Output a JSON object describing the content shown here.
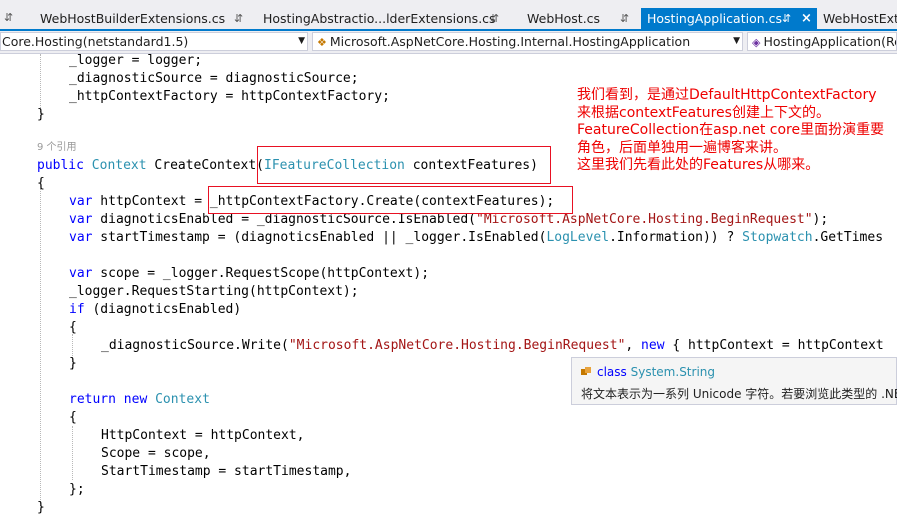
{
  "tabs": [
    {
      "name": "WebHostBuilderExtensions.cs",
      "pin": "⇵",
      "close": "×",
      "active": false
    },
    {
      "name": "HostingAbstractio...lderExtensions.cs",
      "pin": "⇵",
      "close": "×",
      "active": false
    },
    {
      "name": "WebHost.cs",
      "pin": "⇵",
      "close": "×",
      "active": false
    },
    {
      "name": "HostingApplication.cs",
      "pin": "⇵",
      "close": "×",
      "active": true
    },
    {
      "name": "WebHostExte",
      "pin": "",
      "close": "",
      "active": false
    }
  ],
  "left_pin": "⇵",
  "navbar": {
    "project": "Core.Hosting(netstandard1.5)",
    "type": "Microsoft.AspNetCore.Hosting.Internal.HostingApplication",
    "member": "HostingApplication(Re"
  },
  "code": {
    "l1": "_logger = logger;",
    "l2": "_diagnosticSource = diagnosticSource;",
    "l3": "_httpContextFactory = httpContextFactory;",
    "l4": "}",
    "refs": "9 个引用",
    "sig_kw": "public",
    "sig_type": "Context",
    "sig_name": " CreateContext(",
    "sig_param_type": "IFeatureCollection",
    "sig_param": " contextFeatures)",
    "open_brace": "{",
    "var": "var",
    "l5": " httpContext = _httpContextFactory.Create(contextFeatures);",
    "l6a": " diagnoticsEnabled = _diagnosticSource.IsEnabled(",
    "l6s": "\"Microsoft.AspNetCore.Hosting.BeginRequest\"",
    "l6b": ");",
    "l7a": " startTimestamp = (diagnoticsEnabled || _logger.IsEnabled(",
    "l7t": "LogLevel",
    "l7b": ".Information)) ? ",
    "l7t2": "Stopwatch",
    "l7c": ".GetTimes",
    "l8": " scope = _logger.RequestScope(httpContext);",
    "l9": "_logger.RequestStarting(httpContext);",
    "if": "if",
    "l10": " (diagnoticsEnabled)",
    "l11": "{",
    "l12a": "_diagnosticSource.Write(",
    "l12s": "\"Microsoft.AspNetCore.Hosting.BeginRequest\"",
    "l12b": ", ",
    "new": "new",
    "l12c": " { httpContext = httpContext",
    "l13": "}",
    "return": "return",
    "ctx": "Context",
    "l14": "{",
    "l15": "HttpContext = httpContext,",
    "l16": "Scope = scope,",
    "l17": "StartTimestamp = startTimestamp,",
    "l18": "};",
    "l19": "}"
  },
  "annotation": {
    "lines": [
      "我们看到，是通过DefaultHttpContextFactory",
      "来根据contextFeatures创建上下文的。",
      "FeatureCollection在asp.net core里面扮演重要",
      "角色，后面单独用一遍博客来讲。",
      "这里我们先看此处的Features从哪来。"
    ],
    "color": "#ee0000"
  },
  "tooltip": {
    "kw": "class",
    "type": "System.String",
    "desc": "将文本表示为一系列 Unicode 字符。若要浏览此类型的 .NE"
  },
  "colors": {
    "accent": "#007acc",
    "keyword": "#0000ff",
    "type": "#2b91af",
    "string": "#a31515",
    "highlight_box": "#e81123"
  }
}
